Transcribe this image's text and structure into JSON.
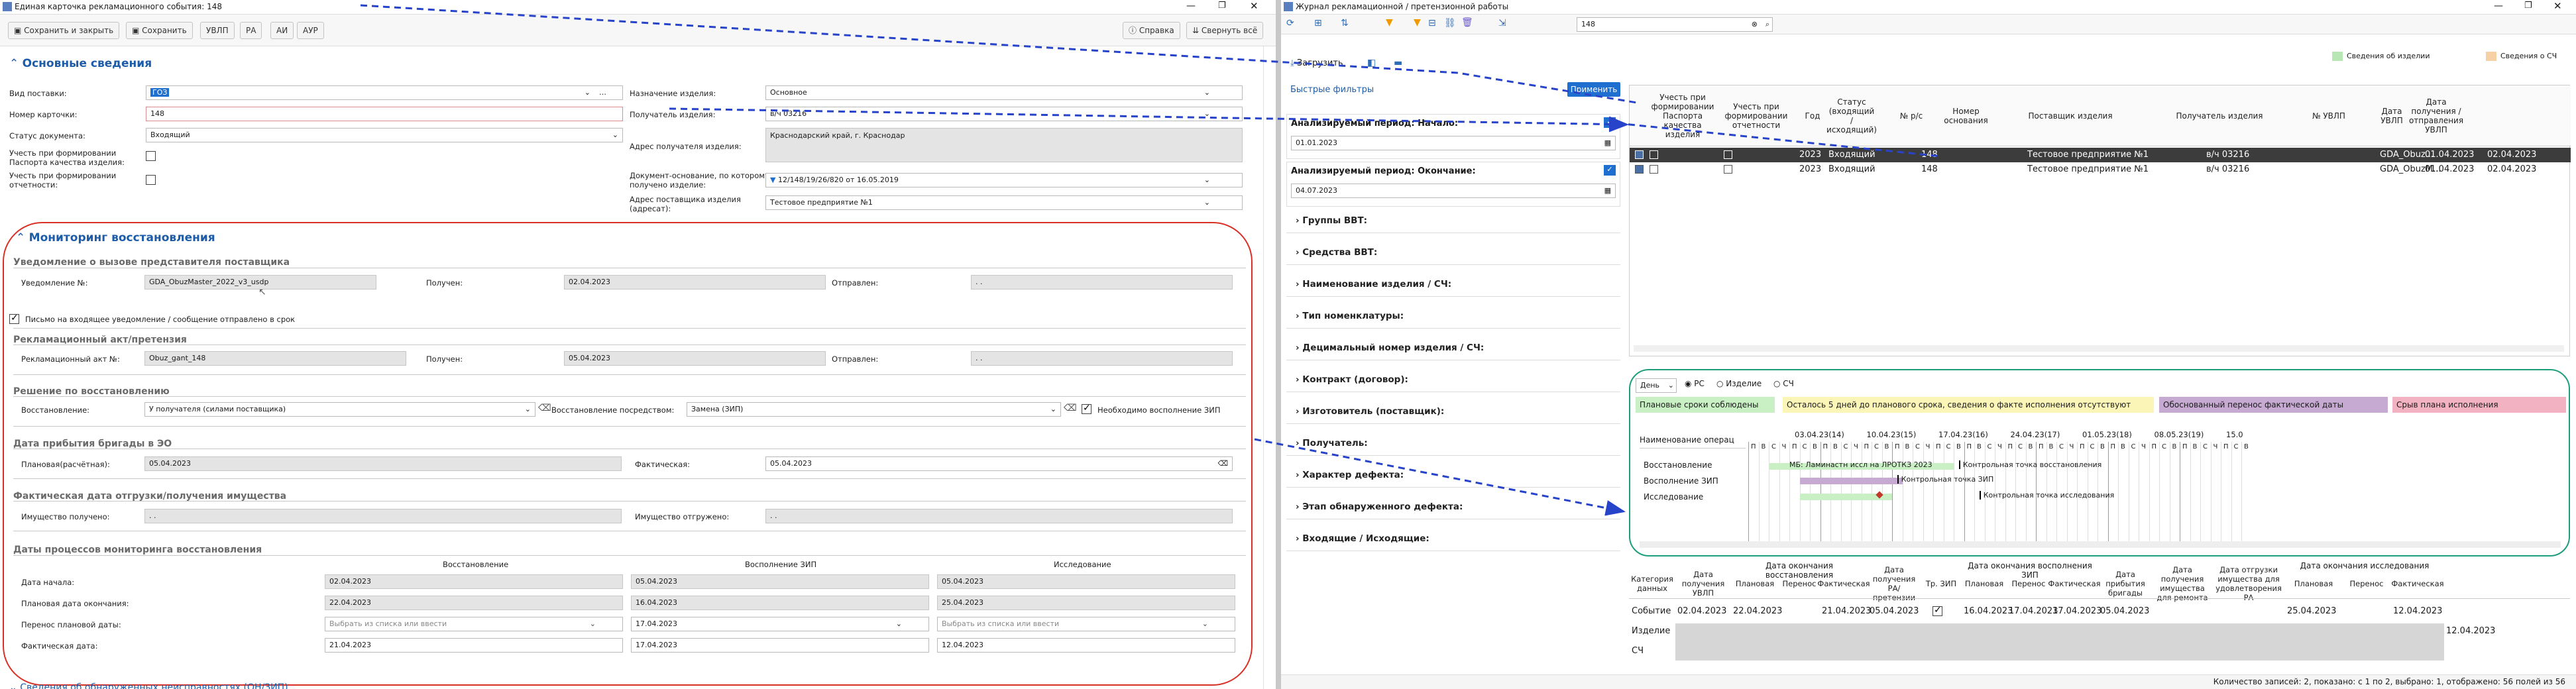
{
  "left": {
    "title": "Единая карточка рекламационного события: 148",
    "toolbar": {
      "save_close": "Сохранить и закрыть",
      "save": "Сохранить",
      "tab1": "УВЛП",
      "tab2": "РА",
      "tab3": "АИ",
      "tab4": "АУР",
      "help": "Справка",
      "collapse": "Свернуть всё"
    },
    "basic": {
      "header": "Основные сведения",
      "delivery_type_label": "Вид поставки:",
      "delivery_type": "ГОЗ",
      "card_no_label": "Номер карточки:",
      "card_no": "148",
      "doc_status_label": "Статус документа:",
      "doc_status": "Входящий",
      "pasport_label": "Учесть при формировании\nПаспорта качества изделия:",
      "report_label": "Учесть при формировании\nотчетности:",
      "purpose_label": "Назначение изделия:",
      "purpose": "Основное",
      "recipient_label": "Получатель изделия:",
      "recipient": "в/ч 03216",
      "recipient_addr_label": "Адрес получателя изделия:",
      "recipient_addr": "Краснодарский край, г. Краснодар",
      "base_doc_label": "Документ-основание, по которому\nполучено изделие:",
      "base_doc": "12/148/19/26/820 от 16.05.2019",
      "supplier_addr_label": "Адрес поставщика изделия\n(адресат):",
      "supplier_addr": "Тестовое предприятие №1"
    },
    "monitoring": {
      "header": "Мониторинг восстановления",
      "notify_title": "Уведомление о вызове представителя поставщика",
      "notify_no_label": "Уведомление №:",
      "notify_no": "GDA_ObuzMaster_2022_v3_usdp",
      "received_label": "Получен:",
      "notify_received": "02.04.2023",
      "sent_label": "Отправлен:",
      "notify_sent": ". .",
      "letter_label": "Письмо на входящее уведомление / сообщение отправлено в срок",
      "act_title": "Рекламационный акт/претензия",
      "act_no_label": "Рекламационный акт №:",
      "act_no": "Obuz_gant_148",
      "act_received": "05.04.2023",
      "act_sent": ". .",
      "restore_title": "Решение по восстановлению",
      "restore_label": "Восстановление:",
      "restore": "У получателя (силами поставщика)",
      "restore_by_label": "Восстановление посредством:",
      "restore_by": "Замена (ЗИП)",
      "need_zip_label": "Необходимо восполнение ЗИП",
      "brigade_title": "Дата прибытия бригады в ЭО",
      "planned_label": "Плановая(расчётная):",
      "brigade_planned": "05.04.2023",
      "actual_label": "Фактическая:",
      "brigade_actual": "05.04.2023",
      "ship_title": "Фактическая дата отгрузки/получения имущества",
      "property_received_label": "Имущество получено:",
      "property_received": ". .",
      "property_shipped_label": "Имущество отгружено:",
      "property_shipped": ". .",
      "dates_title": "Даты процессов мониторинга восстановления",
      "col_restore": "Восстановление",
      "col_zip": "Восполнение ЗИП",
      "col_research": "Исследование",
      "row_start": "Дата начала:",
      "row_plan_end": "Плановая дата окончания:",
      "row_move": "Перенос плановой даты:",
      "row_actual": "Фактическая дата:",
      "start": [
        "02.04.2023",
        "05.04.2023",
        "05.04.2023"
      ],
      "plan_end": [
        "22.04.2023",
        "16.04.2023",
        "25.04.2023"
      ],
      "move_placeholder": "Выбрать из списка или ввести",
      "move_zip": "17.04.2023",
      "actual": [
        "21.04.2023",
        "17.04.2023",
        "12.04.2023"
      ],
      "next_section": "Сведения об обнаруженных неисправностях (ОН/ЗИП)"
    }
  },
  "right": {
    "title": "Журнал рекламационной / претензионной работы",
    "search_value": "148",
    "upload": "Загрузить",
    "legend_items": [
      "Сведения об изделии",
      "Сведения о СЧ"
    ],
    "legend_colors": [
      "#b9e6b5",
      "#f6d1a5"
    ],
    "quick_filters": "Быстрые фильтры",
    "apply": "Применить",
    "period_start_label": "Анализируемый период: Начало:",
    "period_start": "01.01.2023",
    "period_end_label": "Анализируемый период: Окончание:",
    "period_end": "04.07.2023",
    "filters": [
      "Группы ВВТ:",
      "Средства ВВТ:",
      "Наименование изделия / СЧ:",
      "Тип номенклатуры:",
      "Децимальный номер изделия / СЧ:",
      "Контракт (договор):",
      "Изготовитель (поставщик):",
      "Получатель:",
      "Характер дефекта:",
      "Этап обнаруженного дефекта:",
      "Входящие / Исходящие:"
    ],
    "grid": {
      "headers": [
        "Учесть при формировании Паспорта качества изделия",
        "Учесть при формировании отчетности",
        "Год",
        "Статус (входящий / исходящий)",
        "№ р/с",
        "Номер основания",
        "Поставщик изделия",
        "Получатель изделия",
        "№ УВЛП",
        "Дата УВЛП",
        "Дата получения / отправления УВЛП"
      ],
      "rows": [
        {
          "year": "2023",
          "status": "Входящий",
          "no": "148",
          "supplier": "Тестовое предприятие №1",
          "recipient": "в/ч 03216",
          "uvlp": "GDA_Obuz...",
          "date": "01.04.2023",
          "date2": "02.04.2023"
        },
        {
          "year": "2023",
          "status": "Входящий",
          "no": "148",
          "supplier": "Тестовое предприятие №1",
          "recipient": "в/ч 03216",
          "uvlp": "GDA_ObuzM...",
          "date": "01.04.2023",
          "date2": "02.04.2023"
        }
      ]
    },
    "gantt": {
      "scale": "День",
      "radios": [
        "РС",
        "Изделие",
        "СЧ"
      ],
      "legend": [
        "Плановые сроки соблюдены",
        "Осталось 5 дней до планового срока, сведения о факте исполнения отсутствуют",
        "Обоснованный перенос фактической даты",
        "Срыв плана исполнения"
      ],
      "legend_colors": [
        "#c9f0c4",
        "#fbf5b8",
        "#c6aad2",
        "#f2b2c2"
      ],
      "name_header": "Наименование операц",
      "weeks": [
        "03.04.23(14)",
        "10.04.23(15)",
        "17.04.23(16)",
        "24.04.23(17)",
        "01.05.23(18)",
        "08.05.23(19)",
        "15.0"
      ],
      "day_letters": [
        "П",
        "В",
        "С",
        "Ч",
        "П",
        "С",
        "В"
      ],
      "rows": [
        "Восстановление",
        "Восполнение ЗИП",
        "Исследование"
      ],
      "labels": {
        "restore": "МБ: Ламинастн иссл на ЛРОТКЗ 2023",
        "cp_restore": "Контрольная точка восстановления",
        "cp_zip": "Контрольная точка ЗИП",
        "cp_research": "Контрольная точка исследования"
      }
    },
    "table": {
      "group1": "Дата окончания восстановления",
      "group2": "Дата окончания восполнения ЗИП",
      "group3": "Дата окончания исследования",
      "headers": [
        "Категория данных",
        "Дата получения УВЛП",
        "Плановая",
        "Перенос",
        "Фактическая",
        "Дата получения РА/претензии",
        "Тр. ЗИП",
        "Плановая",
        "Перенос",
        "Фактическая",
        "Дата прибытия бригады",
        "Дата получения имущества для ремонта",
        "Дата отгрузки имущества для удовлетворения РА",
        "Плановая",
        "Перенос",
        "Фактическая"
      ],
      "row_labels": [
        "Событие",
        "Изделие",
        "СЧ"
      ],
      "event": [
        "02.04.2023",
        "22.04.2023",
        "",
        "21.04.2023",
        "05.04.2023",
        "",
        "16.04.2023",
        "17.04.2023",
        "17.04.2023",
        "05.04.2023",
        "",
        "",
        "25.04.2023",
        "",
        "12.04.2023"
      ],
      "product_last": "12.04.2023"
    },
    "status_bar": "Количество записей: 2, показано: с 1 по 2, выбрано: 1, отображено: 56 полей из 56"
  }
}
